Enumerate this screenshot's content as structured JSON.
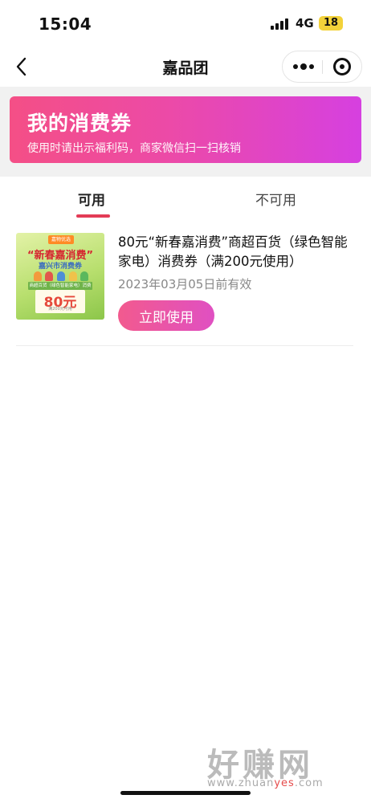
{
  "status_bar": {
    "time": "15:04",
    "network": "4G",
    "battery": "18",
    "signal_icon": "signal-bars-icon"
  },
  "nav": {
    "title": "嘉品团",
    "back_icon": "chevron-left-icon",
    "more_icon": "more-dots-icon",
    "close_icon": "target-circle-icon"
  },
  "banner": {
    "title": "我的消费券",
    "subtitle": "使用时请出示福利码，商家微信扫一扫核销",
    "gradient_start": "#f44f86",
    "gradient_end": "#d640e0"
  },
  "tabs": [
    {
      "label": "可用",
      "active": true
    },
    {
      "label": "不可用",
      "active": false
    }
  ],
  "accent_color": "#e33c56",
  "coupons": [
    {
      "title": "80元“新春嘉消费”商超百货（绿色智能家电）消费券（满200元使用）",
      "expiry": "2023年03月05日前有效",
      "button_label": "立即使用",
      "thumbnail": {
        "tag": "嘉物优选",
        "headline": "“新春嘉消费”",
        "subheadline": "嘉兴市消费券",
        "category": "商超百货（绿色智能家电）消费券",
        "amount": "80元",
        "condition": "满200元可用"
      }
    }
  ],
  "watermark": {
    "text": "好赚网",
    "url_prefix": "www.zhuan",
    "url_highlight": "yes",
    "url_suffix": ".com"
  }
}
